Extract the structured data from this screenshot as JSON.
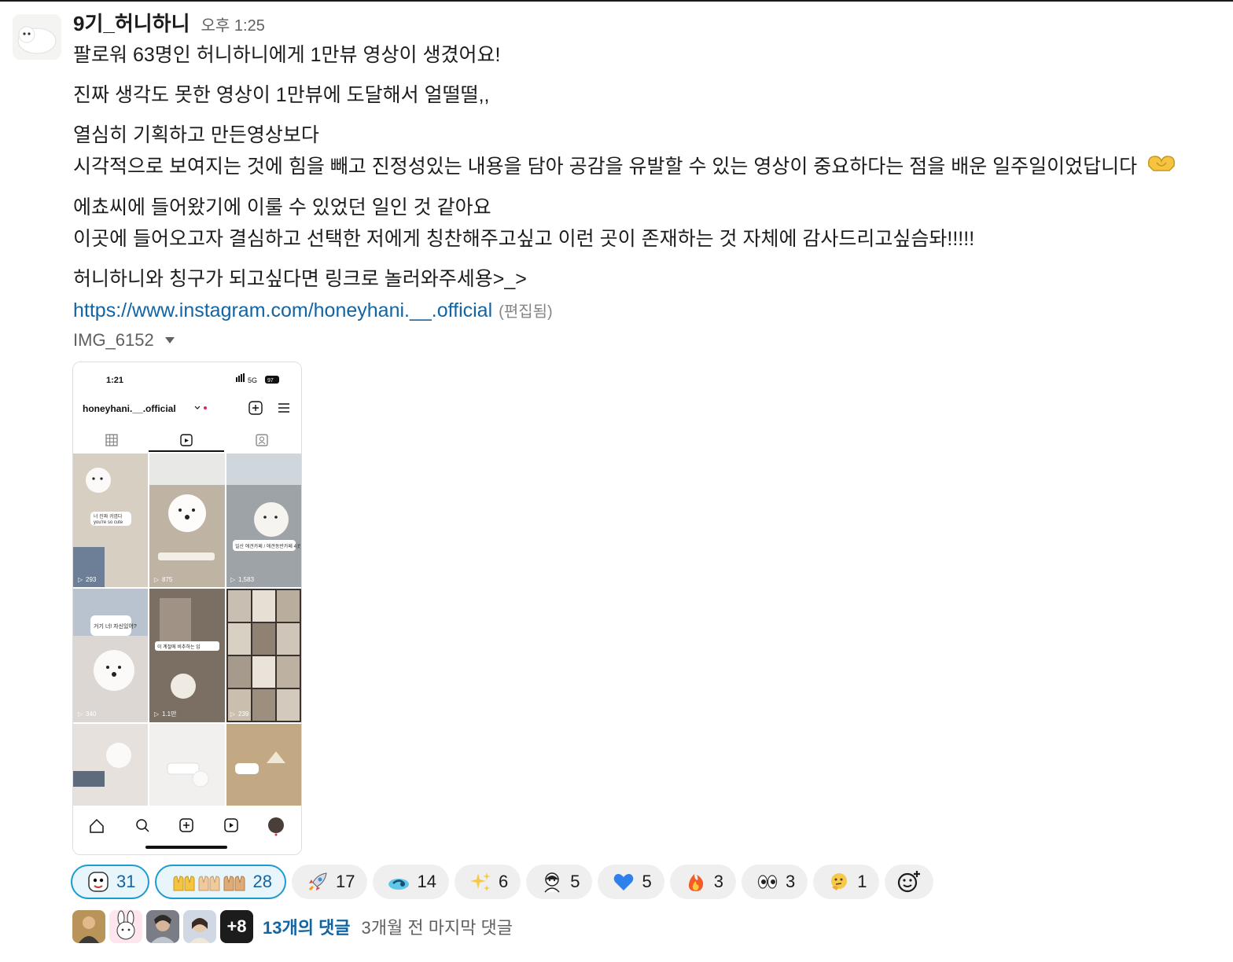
{
  "message": {
    "username": "9기_허니하니",
    "timestamp": "오후 1:25",
    "lines": [
      "팔로워 63명인 허니하니에게 1만뷰 영상이 생겼어요!",
      "진짜 생각도 못한 영상이 1만뷰에 도달해서 얼떨떨,,",
      "열심히 기획하고 만든영상보다",
      "시각적으로 보여지는 것에 힘을 빼고 진정성있는 내용을 담아 공감을 유발할 수 있는 영상이 중요하다는 점을 배운 일주일이었답니다",
      "에쵸씨에 들어왔기에 이룰 수 있었던 일인 것 같아요",
      "이곳에 들어오고자 결심하고 선택한 저에게 칭찬해주고싶고 이런 곳이 존재하는 것 자체에 감사드리고싶슴돠!!!!!",
      "허니하니와 칭구가 되고싶다면 링크로 놀러와주세용>_>"
    ],
    "link": "https://www.instagram.com/honeyhani.__.official",
    "edited": "(편집됨)"
  },
  "attachment": {
    "filename": "IMG_6152",
    "phone_time": "1:21",
    "signal": "5G",
    "battery": "97",
    "account": "honeyhani.__.official",
    "view_counts": [
      "293",
      "875",
      "1,583",
      "340",
      "1.1만",
      "239"
    ],
    "captions": [
      "너 진짜 귀엽다",
      "you're so cute",
      "일산 애견카페 / 애견동반카페 4곳",
      "거기 너! 자신있어?",
      "이 계절에 비추하는 입"
    ]
  },
  "reactions": [
    {
      "icon": "face-icon",
      "count": "31",
      "mine": true
    },
    {
      "icon": "raised-hands-icon",
      "count": "28",
      "mine": true
    },
    {
      "icon": "rocket-icon",
      "count": "17",
      "mine": false
    },
    {
      "icon": "party-icon",
      "count": "14",
      "mine": false
    },
    {
      "icon": "sparkles-icon",
      "count": "6",
      "mine": false
    },
    {
      "icon": "salute-icon",
      "count": "5",
      "mine": false
    },
    {
      "icon": "blue-heart-icon",
      "count": "5",
      "mine": false
    },
    {
      "icon": "fire-icon",
      "count": "3",
      "mine": false
    },
    {
      "icon": "eyes-icon",
      "count": "3",
      "mine": false
    },
    {
      "icon": "thinking-icon",
      "count": "1",
      "mine": false
    }
  ],
  "thread": {
    "more_count": "+8",
    "reply_count": "13개의 댓글",
    "last_reply": "3개월 전 마지막 댓글"
  },
  "colors": {
    "link": "#1264a3",
    "reaction_mine_border": "#1d9bd1",
    "reaction_bg": "#efefef"
  }
}
